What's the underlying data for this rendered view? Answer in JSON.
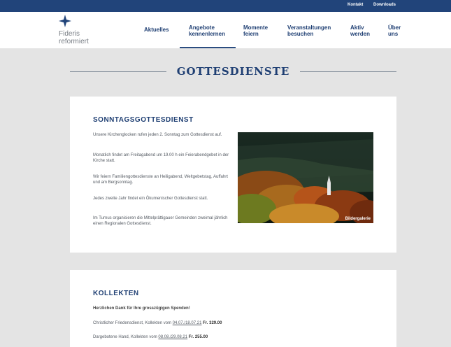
{
  "topbar": {
    "links": [
      "Kontakt",
      "Downloads"
    ]
  },
  "logo": {
    "line1": "Fideris",
    "line2": "reformiert"
  },
  "nav": {
    "items": [
      {
        "lines": [
          "Aktuelles"
        ]
      },
      {
        "lines": [
          "Angebote",
          "kennenlernen"
        ]
      },
      {
        "lines": [
          "Momente",
          "feiern"
        ]
      },
      {
        "lines": [
          "Veranstaltungen",
          "besuchen"
        ]
      },
      {
        "lines": [
          "Aktiv",
          "werden"
        ]
      },
      {
        "lines": [
          "Über",
          "uns"
        ]
      }
    ]
  },
  "page": {
    "title": "GOTTESDIENSTE"
  },
  "sunday": {
    "heading": "SONNTAGSGOTTESDIENST",
    "paragraphs": [
      "Unsere Kirchenglocken rufen jeden 2. Sonntag zum Gottesdienst auf.",
      "Monatlich findet am Freitagabend um 19.00 h ein Feierabendgebet in der Kirche statt.",
      "Wir feiern Familiengottesdienste an Heiligabend, Weltgebetstag, Auffahrt und am Bergsonntag.",
      "Jedes zweite Jahr findet ein Ökumenischer Gottesdienst statt.",
      "Im Turnus organisieren die Mittelprättigauer Gemeinden zweimal jährlich einen Regionalen Gottesdienst."
    ],
    "gallery_label": "Bildergalerie"
  },
  "kollekten": {
    "heading": "KOLLEKTEN",
    "thanks": "Herzlichen Dank für Ihre grosszügigen Spenden!",
    "items": [
      {
        "name": "Christlicher Friedensdienst, Kollekten vom",
        "dates": "04.07./18.07.21",
        "amount_prefix": "Fr.",
        "amount": "329.00"
      },
      {
        "name": "Dargebotene Hand, Kollekten vom",
        "dates": "08.08./29.08.21",
        "amount_prefix": "Fr.",
        "amount": "255.00"
      }
    ]
  },
  "colors": {
    "brand": "#21447a",
    "accent_text": "#1f3f73",
    "page_bg": "#e4e4e4"
  }
}
